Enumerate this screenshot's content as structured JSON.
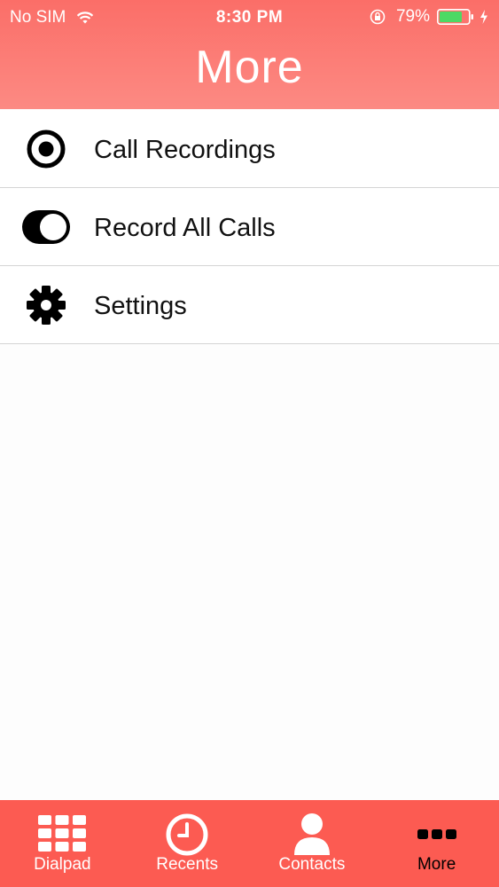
{
  "status_bar": {
    "carrier": "No SIM",
    "time": "8:30 PM",
    "battery_percent": "79%",
    "battery_level": 0.79,
    "icons": [
      "wifi-icon",
      "rotation-lock-icon",
      "battery-icon",
      "charging-bolt-icon"
    ]
  },
  "header": {
    "title": "More",
    "color": "#fb7a74"
  },
  "menu": {
    "items": [
      {
        "label": "Call Recordings",
        "icon": "record-icon"
      },
      {
        "label": "Record All Calls",
        "icon": "toggle-icon",
        "toggle_on": true
      },
      {
        "label": "Settings",
        "icon": "gear-icon"
      }
    ]
  },
  "tabbar": {
    "color": "#fc5b52",
    "active_color": "#000000",
    "tabs": [
      {
        "label": "Dialpad",
        "icon": "dialpad-icon",
        "active": false
      },
      {
        "label": "Recents",
        "icon": "clock-icon",
        "active": false
      },
      {
        "label": "Contacts",
        "icon": "person-icon",
        "active": false
      },
      {
        "label": "More",
        "icon": "more-dots-icon",
        "active": true
      }
    ]
  }
}
